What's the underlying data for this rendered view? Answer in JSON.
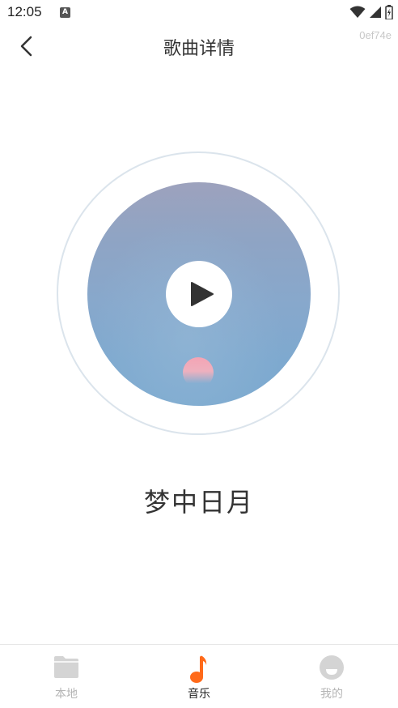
{
  "status_bar": {
    "time": "12:05",
    "app_icon_letter": "A",
    "icons": [
      "wifi-icon",
      "signal-icon",
      "battery-icon"
    ]
  },
  "header": {
    "title": "歌曲详情",
    "back_icon": "chevron-left-icon",
    "hash_label": "0ef74e"
  },
  "player": {
    "song_name": "梦中日月",
    "play_icon": "play-icon"
  },
  "bottom_nav": {
    "items": [
      {
        "label": "本地",
        "icon": "folder-icon",
        "active": false
      },
      {
        "label": "音乐",
        "icon": "music-note-icon",
        "active": true
      },
      {
        "label": "我的",
        "icon": "profile-icon",
        "active": false
      }
    ]
  },
  "colors": {
    "accent": "#ff6a1a",
    "inactive": "#b5b5b5",
    "disc_ring": "#dbe4ec"
  }
}
